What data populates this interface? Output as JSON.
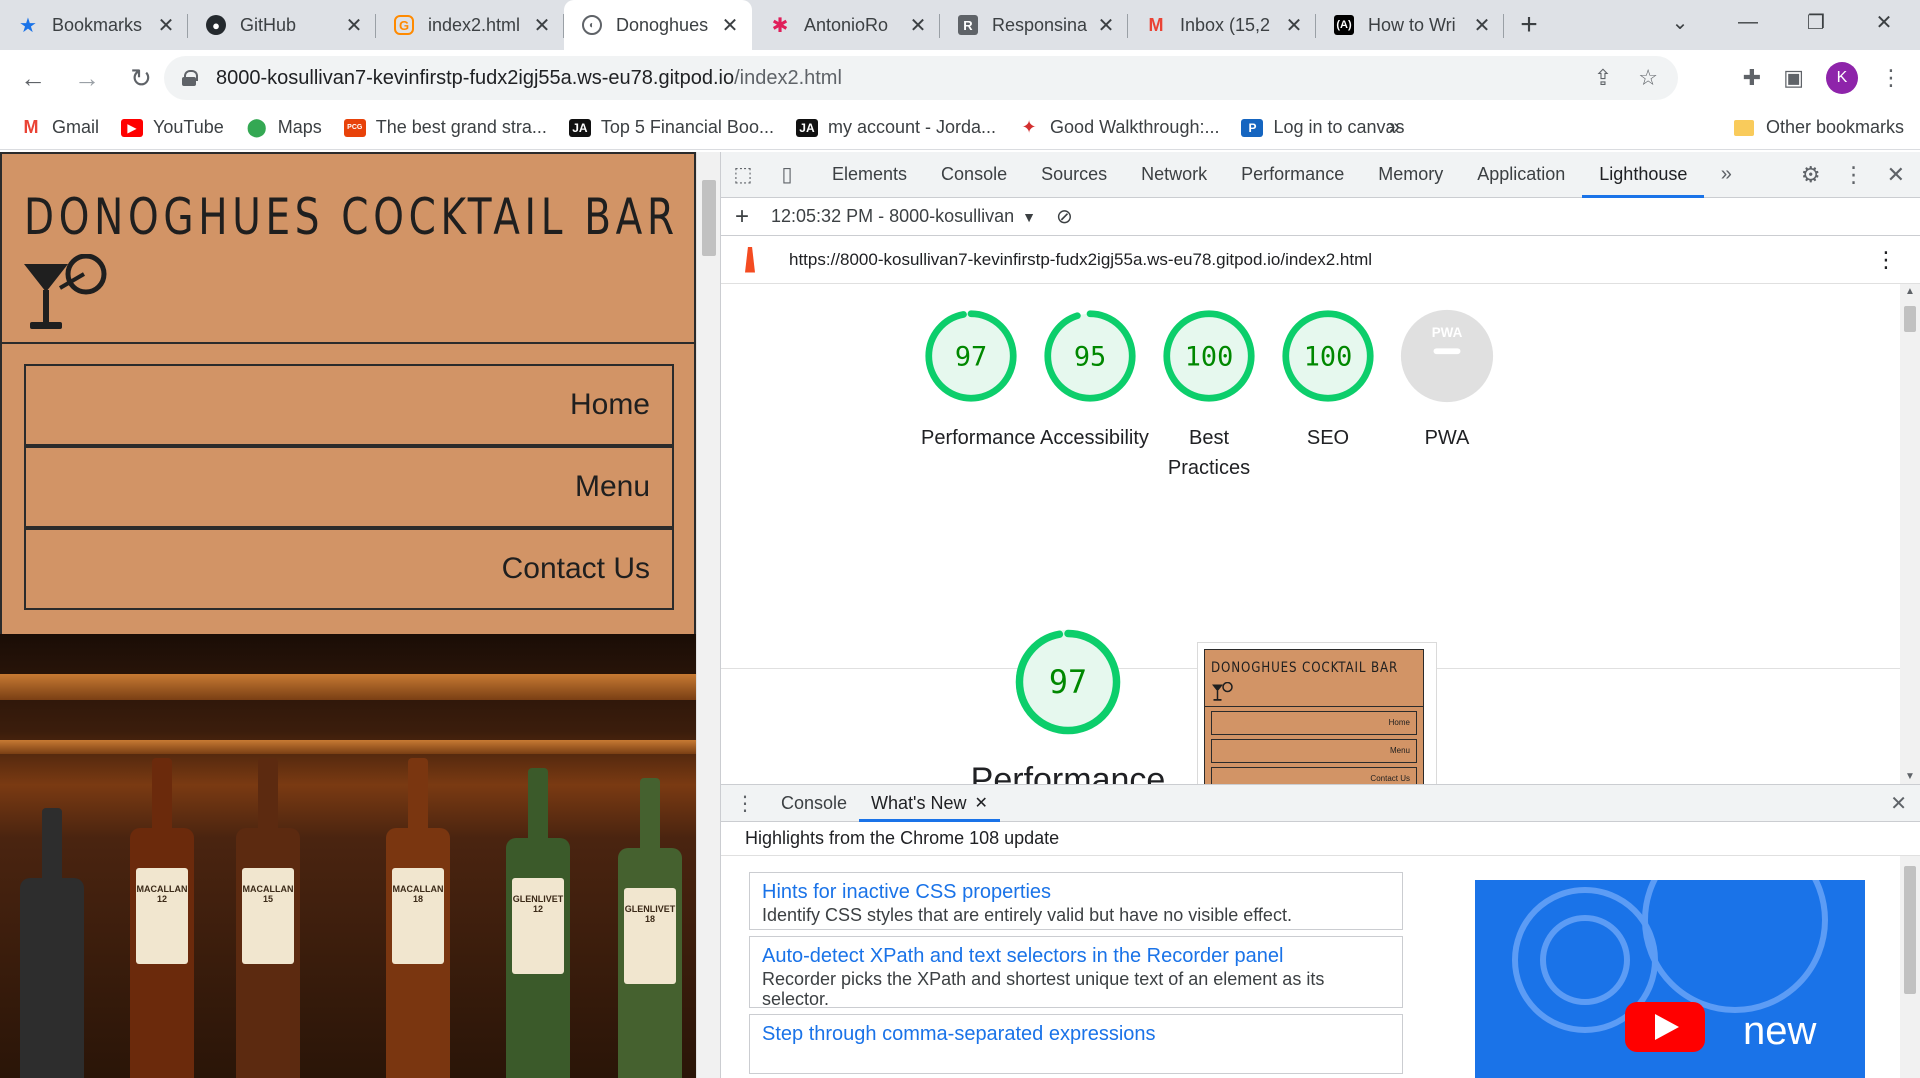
{
  "browser": {
    "tabs": [
      {
        "title": "Bookmarks",
        "icon": "star-icon",
        "active": false
      },
      {
        "title": "GitHub",
        "icon": "github-icon",
        "active": false
      },
      {
        "title": "index2.html",
        "icon": "gitpod-icon",
        "active": false
      },
      {
        "title": "Donoghues",
        "icon": "globe-icon",
        "active": true
      },
      {
        "title": "AntonioRo",
        "icon": "slack-icon",
        "active": false
      },
      {
        "title": "Responsina",
        "icon": "r-icon",
        "active": false
      },
      {
        "title": "Inbox (15,2",
        "icon": "gmail-icon",
        "active": false
      },
      {
        "title": "How to Wri",
        "icon": "code-icon",
        "active": false
      }
    ],
    "url_host": "8000-kosullivan7-kevinfirstp-fudx2igj55a.ws-eu78.gitpod.io",
    "url_path": "/index2.html",
    "profile_initial": "K",
    "bookmarks": [
      {
        "label": "Gmail",
        "icon": "gmail-icon"
      },
      {
        "label": "YouTube",
        "icon": "youtube-icon"
      },
      {
        "label": "Maps",
        "icon": "maps-icon"
      },
      {
        "label": "The best grand stra...",
        "icon": "pcgamer-icon"
      },
      {
        "label": "Top 5 Financial Boo...",
        "icon": "ja-icon"
      },
      {
        "label": "my account - Jorda...",
        "icon": "ja-icon"
      },
      {
        "label": "Good Walkthrough:...",
        "icon": "game-icon"
      },
      {
        "label": "Log in to canvas",
        "icon": "p-icon"
      }
    ],
    "bookmarks_more": "»",
    "other_bookmarks": "Other bookmarks"
  },
  "site": {
    "title": "DONOGHUES COCKTAIL BAR",
    "nav": [
      "Home",
      "Menu",
      "Contact Us"
    ],
    "bottle_labels": [
      "MACALLAN 12",
      "MACALLAN 15",
      "MACALLAN 18",
      "GLENLIVET 12",
      "GLENLIVET 18"
    ]
  },
  "devtools": {
    "tabs": [
      "Elements",
      "Console",
      "Sources",
      "Network",
      "Performance",
      "Memory",
      "Application",
      "Lighthouse"
    ],
    "active_tab": "Lighthouse",
    "report_select": "12:05:32 PM - 8000-kosullivan",
    "report_url": "https://8000-kosullivan7-kevinfirstp-fudx2igj55a.ws-eu78.gitpod.io/index2.html",
    "scores": [
      {
        "label": "Performance",
        "value": "97",
        "score": 0.97
      },
      {
        "label": "Accessibility",
        "value": "95",
        "score": 0.95
      },
      {
        "label": "Best Practices",
        "value": "100",
        "score": 1.0
      },
      {
        "label": "SEO",
        "value": "100",
        "score": 1.0
      },
      {
        "label": "PWA",
        "value": "PWA",
        "score": null
      }
    ],
    "detail_score": {
      "label": "Performance",
      "value": "97",
      "score": 0.97
    },
    "thumbnail": {
      "title": "DONOGHUES COCKTAIL BAR",
      "nav": [
        "Home",
        "Menu",
        "Contact Us"
      ]
    },
    "drawer_tabs": [
      "Console",
      "What's New"
    ],
    "drawer_active": "What's New",
    "highlights": "Highlights from the Chrome 108 update",
    "whats_new": [
      {
        "heading": "Hints for inactive CSS properties",
        "desc": "Identify CSS styles that are entirely valid but have no visible effect."
      },
      {
        "heading": "Auto-detect XPath and text selectors in the Recorder panel",
        "desc": "Recorder picks the XPath and shortest unique text of an element as its selector."
      },
      {
        "heading": "Step through comma-separated expressions",
        "desc": ""
      }
    ],
    "video_caption": "new"
  },
  "colors": {
    "score_good": "#0cce6b",
    "score_bg": "#e6f8ee",
    "score_text": "#008800",
    "site_orange": "#d29466",
    "devtools_accent": "#1a73e8"
  }
}
